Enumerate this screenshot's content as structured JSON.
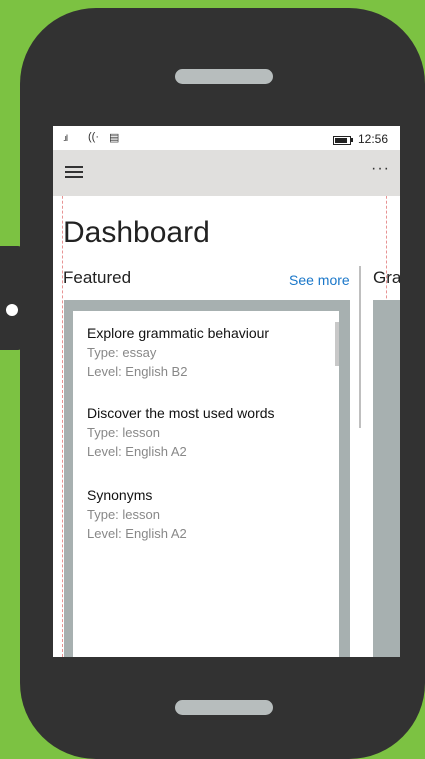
{
  "status_bar": {
    "signal_icon": "signal-icon",
    "wifi_icon": "wifi-icon",
    "message_icon": "message-icon",
    "battery_icon": "battery-icon",
    "time": "12:56"
  },
  "app_bar": {
    "menu_icon": "hamburger-icon",
    "more_label": "···"
  },
  "page": {
    "title": "Dashboard"
  },
  "featured": {
    "title": "Featured",
    "see_more": "See more",
    "items": [
      {
        "title": "Explore grammatic behaviour",
        "type": "Type: essay",
        "level": "Level: English B2"
      },
      {
        "title": "Discover the most used words",
        "type": "Type: lesson",
        "level": "Level: English A2"
      },
      {
        "title": "Synonyms",
        "type": "Type: lesson",
        "level": "Level: English A2"
      }
    ]
  },
  "second_section": {
    "title_partial": "Gra"
  },
  "colors": {
    "background": "#7cc242",
    "phone": "#323232",
    "accent": "#1a77c9",
    "panel": "#a7b0b0"
  }
}
